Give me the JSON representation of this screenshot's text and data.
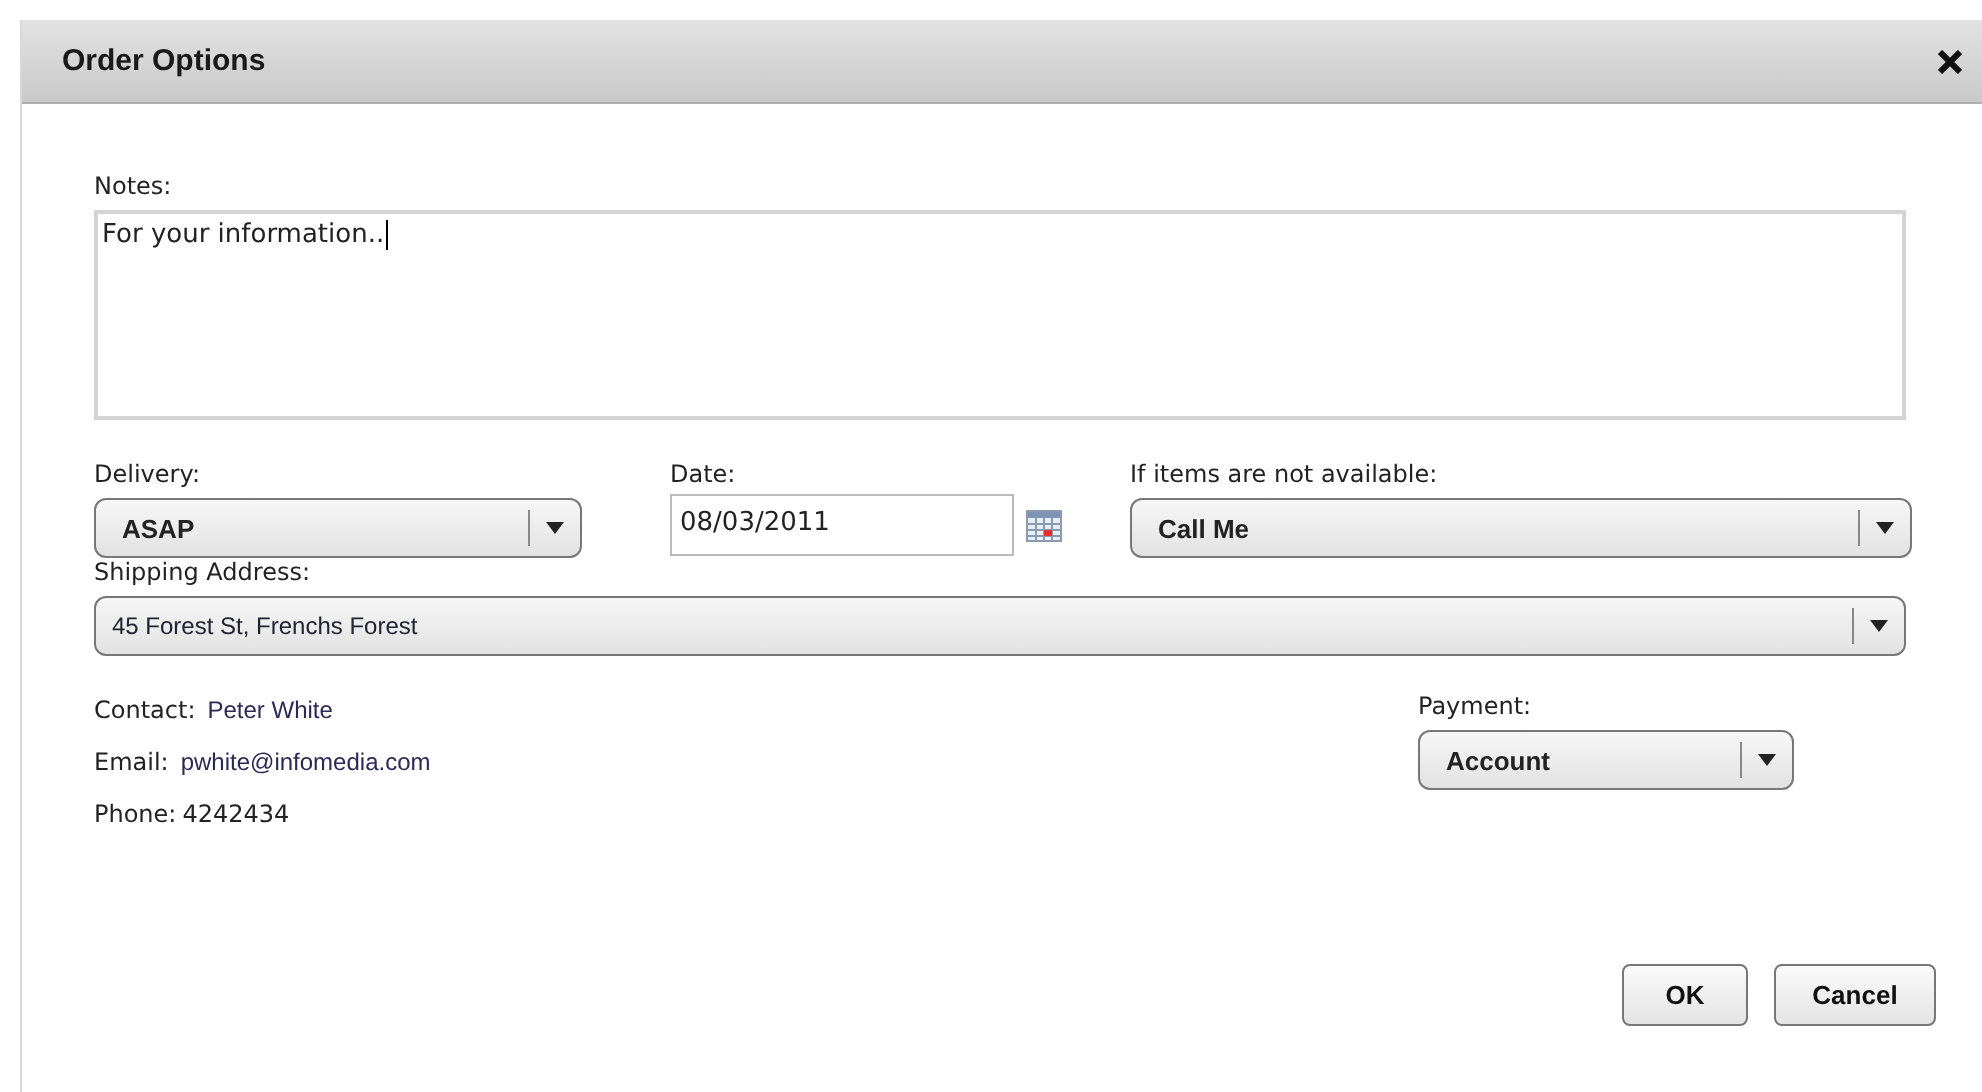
{
  "window": {
    "title": "Order Options"
  },
  "notes": {
    "label": "Notes:",
    "value": "For your information.."
  },
  "delivery": {
    "label": "Delivery:",
    "value": "ASAP"
  },
  "date": {
    "label": "Date:",
    "value": "08/03/2011"
  },
  "unavailable": {
    "label": "If items are not available:",
    "value": "Call Me"
  },
  "shipping": {
    "label": "Shipping Address:",
    "value": "45 Forest St, Frenchs Forest"
  },
  "contact": [
    {
      "label": "Contact:",
      "value": "Peter White"
    },
    {
      "label": "Email:",
      "value": "pwhite@infomedia.com"
    },
    {
      "label": "Phone:",
      "value": "4242434"
    }
  ],
  "payment": {
    "label": "Payment:",
    "value": "Account"
  },
  "buttons": [
    "OK",
    "Cancel"
  ]
}
